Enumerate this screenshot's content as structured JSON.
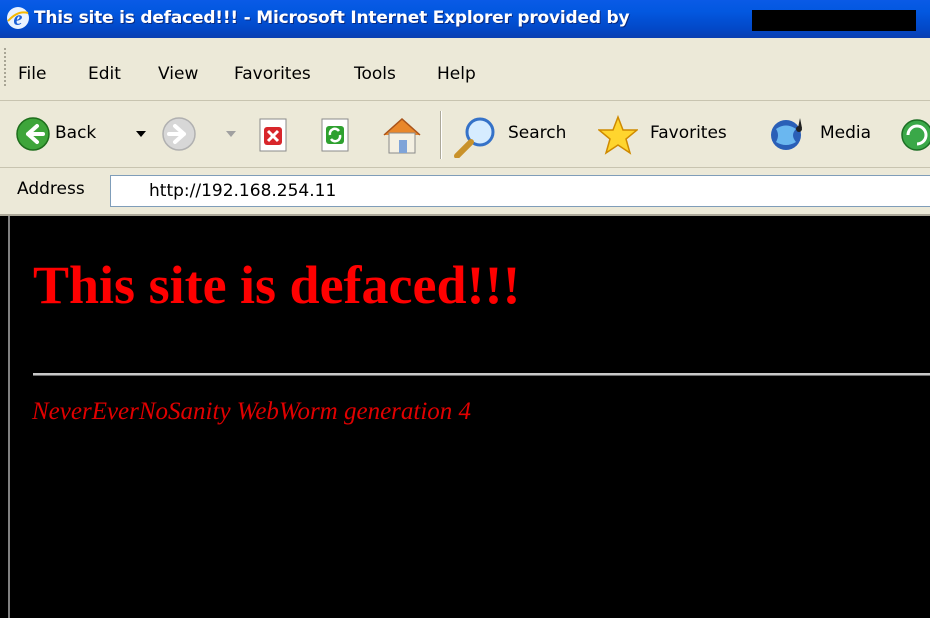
{
  "window": {
    "title": "This site is defaced!!! - Microsoft Internet Explorer provided by"
  },
  "menu": {
    "items": [
      "File",
      "Edit",
      "View",
      "Favorites",
      "Tools",
      "Help"
    ]
  },
  "toolbar": {
    "back_label": "Back",
    "search_label": "Search",
    "favorites_label": "Favorites",
    "media_label": "Media"
  },
  "address": {
    "label": "Address",
    "url": "http://192.168.254.11"
  },
  "page": {
    "heading": "This site is defaced!!!",
    "subtext": "NeverEverNoSanity WebWorm generation 4",
    "background_color": "#000000",
    "text_color": "#ff0000"
  }
}
